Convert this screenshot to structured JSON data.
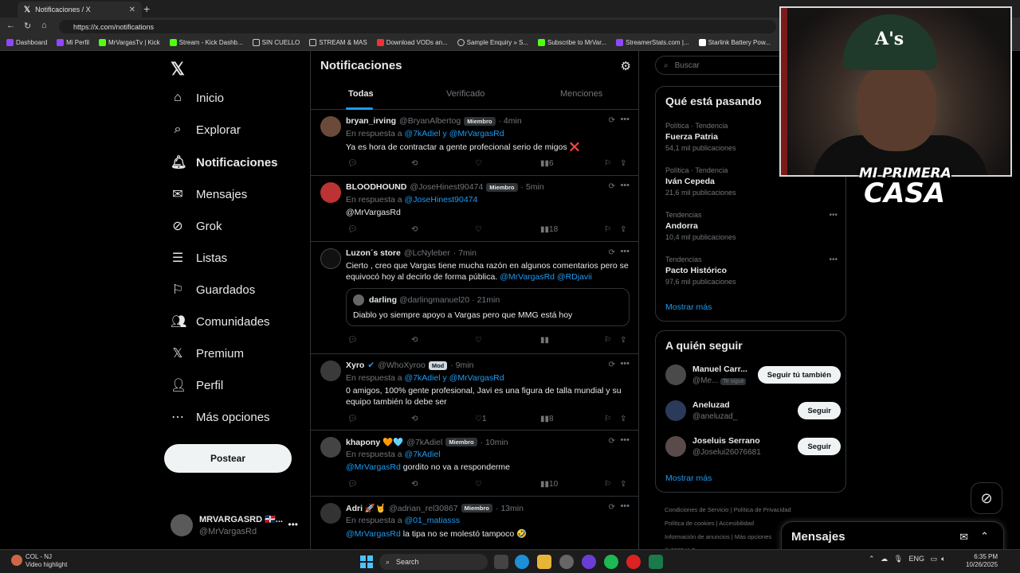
{
  "browser": {
    "tab_title": "Notificaciones / X",
    "url": "https://x.com/notifications",
    "bookmarks": [
      "Dashboard",
      "Mi Perfil",
      "MrVargasTv | Kick",
      "Stream - Kick Dashb...",
      "SIN CUELLO",
      "STREAM & MAS",
      "Download VODs an...",
      "Sample Enquiry » S...",
      "Subscribe to MrVar...",
      "StreamerStats.com |...",
      "Starlink Battery Pow..."
    ]
  },
  "nav": {
    "items": [
      "Inicio",
      "Explorar",
      "Notificaciones",
      "Mensajes",
      "Grok",
      "Listas",
      "Guardados",
      "Comunidades",
      "Premium",
      "Perfil",
      "Más opciones"
    ],
    "post_label": "Postear",
    "profile_name": "MRVARGASRD 🇩🇴...",
    "profile_handle": "@MrVargasRd"
  },
  "center": {
    "title": "Notificaciones",
    "tabs": [
      "Todas",
      "Verificado",
      "Menciones"
    ]
  },
  "tweets": [
    {
      "name": "bryan_irving",
      "handle": "@BryanAlbertog",
      "badge": "Miembro",
      "time": "· 4min",
      "reply_prefix": "En respuesta a ",
      "reply_to": "@7kAdiel y @MrVargasRd",
      "text": "Ya es hora de contractar a gente profecional serio de migos ❌",
      "views": "6"
    },
    {
      "name": "BLOODHOUND",
      "handle": "@JoseHinest90474",
      "badge": "Miembro",
      "time": "· 5min",
      "reply_prefix": "En respuesta a ",
      "reply_to": "@JoseHinest90474",
      "text_mention": "@MrVargasRd",
      "views": "18"
    },
    {
      "name": "Luzon´s store",
      "handle": "@LcNyleber",
      "time": "· 7min",
      "text1": "Cierto , creo que Vargas tiene mucha razón en  algunos comentarios pero se",
      "text2": "equivocó hoy al decirlo de forma pública.",
      "mentions": "@MrVargasRd  @RDjavii",
      "quote_name": "darling",
      "quote_handle": "@darlingmanuel20",
      "quote_time": "· 21min",
      "quote_text": "Diablo yo siempre apoyo a Vargas pero que MMG está hoy"
    },
    {
      "name": "Xyro",
      "handle": "@WhoXyroo",
      "badge": "Mod",
      "time": "· 9min",
      "reply_prefix": "En respuesta a ",
      "reply_to": "@7kAdiel y @MrVargasRd",
      "text1": "0 amigos, 100% gente profesional, Javi es una figura de talla mundial y su",
      "text2": "equipo también lo debe ser",
      "likes": "1",
      "views": "8"
    },
    {
      "name": "khapony 🧡🩵",
      "handle": "@7kAdiel",
      "badge": "Miembro",
      "time": "· 10min",
      "reply_prefix": "En respuesta a ",
      "reply_to": "@7kAdiel",
      "text_mention": "@MrVargasRd",
      "text": " gordito no va a responderme",
      "views": "10"
    },
    {
      "name": "Adri 🚀🤘",
      "handle": "@adrian_rel30867",
      "badge": "Miembro",
      "time": "· 13min",
      "reply_prefix": "En respuesta a ",
      "reply_to": "@01_matiasss",
      "text_mention": "@MrVargasRd",
      "text": " la tipa no se molestó tampoco 🤣"
    }
  ],
  "right": {
    "search_placeholder": "Buscar",
    "trending_title": "Qué está pasando",
    "trends": [
      {
        "category": "Política · Tendencia",
        "title": "Fuerza Patria",
        "count": "54,1 mil publicaciones"
      },
      {
        "category": "Política · Tendencia",
        "title": "Iván Cepeda",
        "count": "21,6 mil publicaciones"
      },
      {
        "category": "Tendencias",
        "title": "Andorra",
        "count": "10,4 mil publicaciones"
      },
      {
        "category": "Tendencias",
        "title": "Pacto Histórico",
        "count": "97,6 mil publicaciones"
      }
    ],
    "show_more": "Mostrar más",
    "follow_title": "A quién seguir",
    "follows": [
      {
        "name": "Manuel Carr...",
        "handle": "@Me...",
        "tag": "Te sigue",
        "button": "Seguir tú también"
      },
      {
        "name": "Aneluzad",
        "handle": "@aneluzad_",
        "button": "Seguir"
      },
      {
        "name": "Joseluis Serrano",
        "handle": "@Joselui26076681",
        "button": "Seguir"
      }
    ],
    "footer": [
      "Condiciones de Servicio",
      "Política de Privacidad",
      "Política de cookies",
      "Accesibilidad",
      "Información de anuncios",
      "Más opciones",
      "© 2025 X Corp."
    ]
  },
  "overlay": {
    "cap_text": "A's",
    "brand_line1": "MI PRIMERA",
    "brand_line2": "CASA"
  },
  "messages_label": "Mensajes",
  "taskbar": {
    "weather_title": "COL - NJ",
    "weather_sub": "Video highlight",
    "search": "Search",
    "lang": "ENG",
    "time": "6:35 PM",
    "date": "10/26/2025"
  },
  "colors": {
    "accent": "#1d9bf0",
    "bg": "#000000",
    "border": "#2f3336"
  }
}
